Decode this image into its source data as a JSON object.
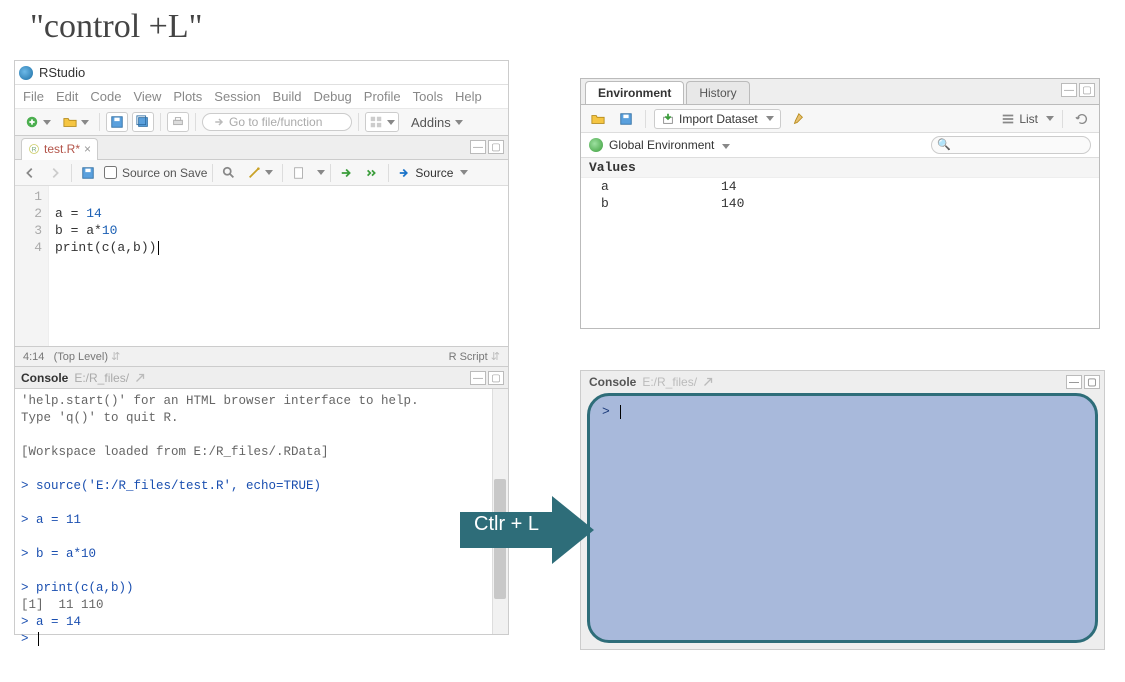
{
  "slide": {
    "title": "\"control +L\""
  },
  "app": {
    "title": "RStudio",
    "menus": [
      "File",
      "Edit",
      "Code",
      "View",
      "Plots",
      "Session",
      "Build",
      "Debug",
      "Profile",
      "Tools",
      "Help"
    ],
    "goto_placeholder": "Go to file/function",
    "addins_label": "Addins"
  },
  "editor": {
    "tab_name": "test.R*",
    "source_on_save": "Source on Save",
    "source_label": "Source",
    "lines": [
      {
        "n": "1",
        "code": ""
      },
      {
        "n": "2",
        "code": "a = 14"
      },
      {
        "n": "3",
        "code": "b = a*10"
      },
      {
        "n": "4",
        "code": "print(c(a,b))"
      }
    ],
    "status_pos": "4:14",
    "status_scope": "(Top Level)",
    "status_type": "R Script"
  },
  "console_left": {
    "title": "Console",
    "path": "E:/R_files/",
    "lines": [
      {
        "cls": "grey",
        "text": "'help.start()' for an HTML browser interface to help."
      },
      {
        "cls": "grey",
        "text": "Type 'q()' to quit R."
      },
      {
        "cls": "grey",
        "text": ""
      },
      {
        "cls": "grey",
        "text": "[Workspace loaded from E:/R_files/.RData]"
      },
      {
        "cls": "grey",
        "text": ""
      },
      {
        "cls": "blue",
        "text": "> source('E:/R_files/test.R', echo=TRUE)"
      },
      {
        "cls": "grey",
        "text": ""
      },
      {
        "cls": "blue",
        "text": "> a = 11"
      },
      {
        "cls": "grey",
        "text": ""
      },
      {
        "cls": "blue",
        "text": "> b = a*10"
      },
      {
        "cls": "grey",
        "text": ""
      },
      {
        "cls": "blue",
        "text": "> print(c(a,b))"
      },
      {
        "cls": "grey",
        "text": "[1]  11 110"
      },
      {
        "cls": "blue",
        "text": "> a = 14"
      },
      {
        "cls": "blue",
        "text": "> "
      }
    ]
  },
  "env": {
    "tabs": {
      "active": "Environment",
      "other": "History"
    },
    "import_label": "Import Dataset",
    "list_label": "List",
    "scope_label": "Global Environment",
    "search_placeholder": "",
    "section": "Values",
    "rows": [
      {
        "name": "a",
        "value": "14"
      },
      {
        "name": "b",
        "value": "140"
      }
    ]
  },
  "console_right": {
    "title": "Console",
    "path": "E:/R_files/",
    "prompt": ">"
  },
  "arrow": {
    "label": "Ctlr  + L"
  }
}
